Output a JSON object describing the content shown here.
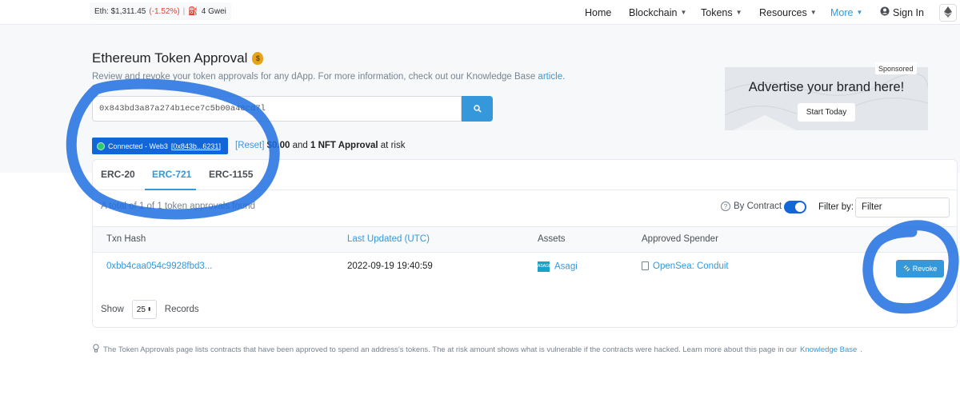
{
  "topbar": {
    "eth_label": "Eth: $1,311.45",
    "eth_change": "(-1.52%)",
    "separator": "|",
    "gas": "4 Gwei",
    "nav": [
      "Home",
      "Blockchain",
      "Tokens",
      "Resources",
      "More"
    ],
    "sign_in": "Sign In"
  },
  "page": {
    "title": "Ethereum Token Approval",
    "subtitle": "Review and revoke your token approvals for any dApp. For more information, check out our Knowledge Base",
    "subtitle_link": "article.",
    "search_value": "0x843bd3a87a274b1ece7c5b00a48cd7l",
    "connected_prefix": "Connected - Web3",
    "connected_address": "[0x843b...6231]",
    "reset": "[Reset]",
    "risk_amount": "$0.00",
    "risk_and": "and",
    "risk_nft": "1 NFT Approval",
    "risk_suffix": "at risk"
  },
  "ad": {
    "sponsored": "Sponsored",
    "headline": "Advertise your brand here!",
    "button": "Start Today"
  },
  "card": {
    "tabs": [
      "ERC-20",
      "ERC-721",
      "ERC-1155"
    ],
    "active_tab": "ERC-721",
    "found_text": "A total of 1 of 1 token approvals found",
    "by_contract": "By Contract",
    "filter_by": "Filter by:",
    "filter_value": "Filter",
    "columns": [
      "Txn Hash",
      "Last Updated (UTC)",
      "Assets",
      "Approved Spender"
    ],
    "rows": [
      {
        "txn_hash": "0xbb4caa054c9928fbd3...",
        "last_updated": "2022-09-19 19:40:59",
        "asset": "Asagi",
        "spender": "OpenSea: Conduit",
        "action": "Revoke"
      }
    ],
    "show_label": "Show",
    "records_value": "25",
    "records_label": "Records"
  },
  "footer": {
    "note": "The Token Approvals page lists contracts that have been approved to spend an address's tokens. The at risk amount shows what is vulnerable if the contracts were hacked. Learn more about this page in our",
    "link": "Knowledge Base",
    "end": "."
  },
  "colors": {
    "accent": "#3498db",
    "connected": "#1266d8",
    "negative": "#de4437",
    "annotation": "#1e6fe0"
  }
}
